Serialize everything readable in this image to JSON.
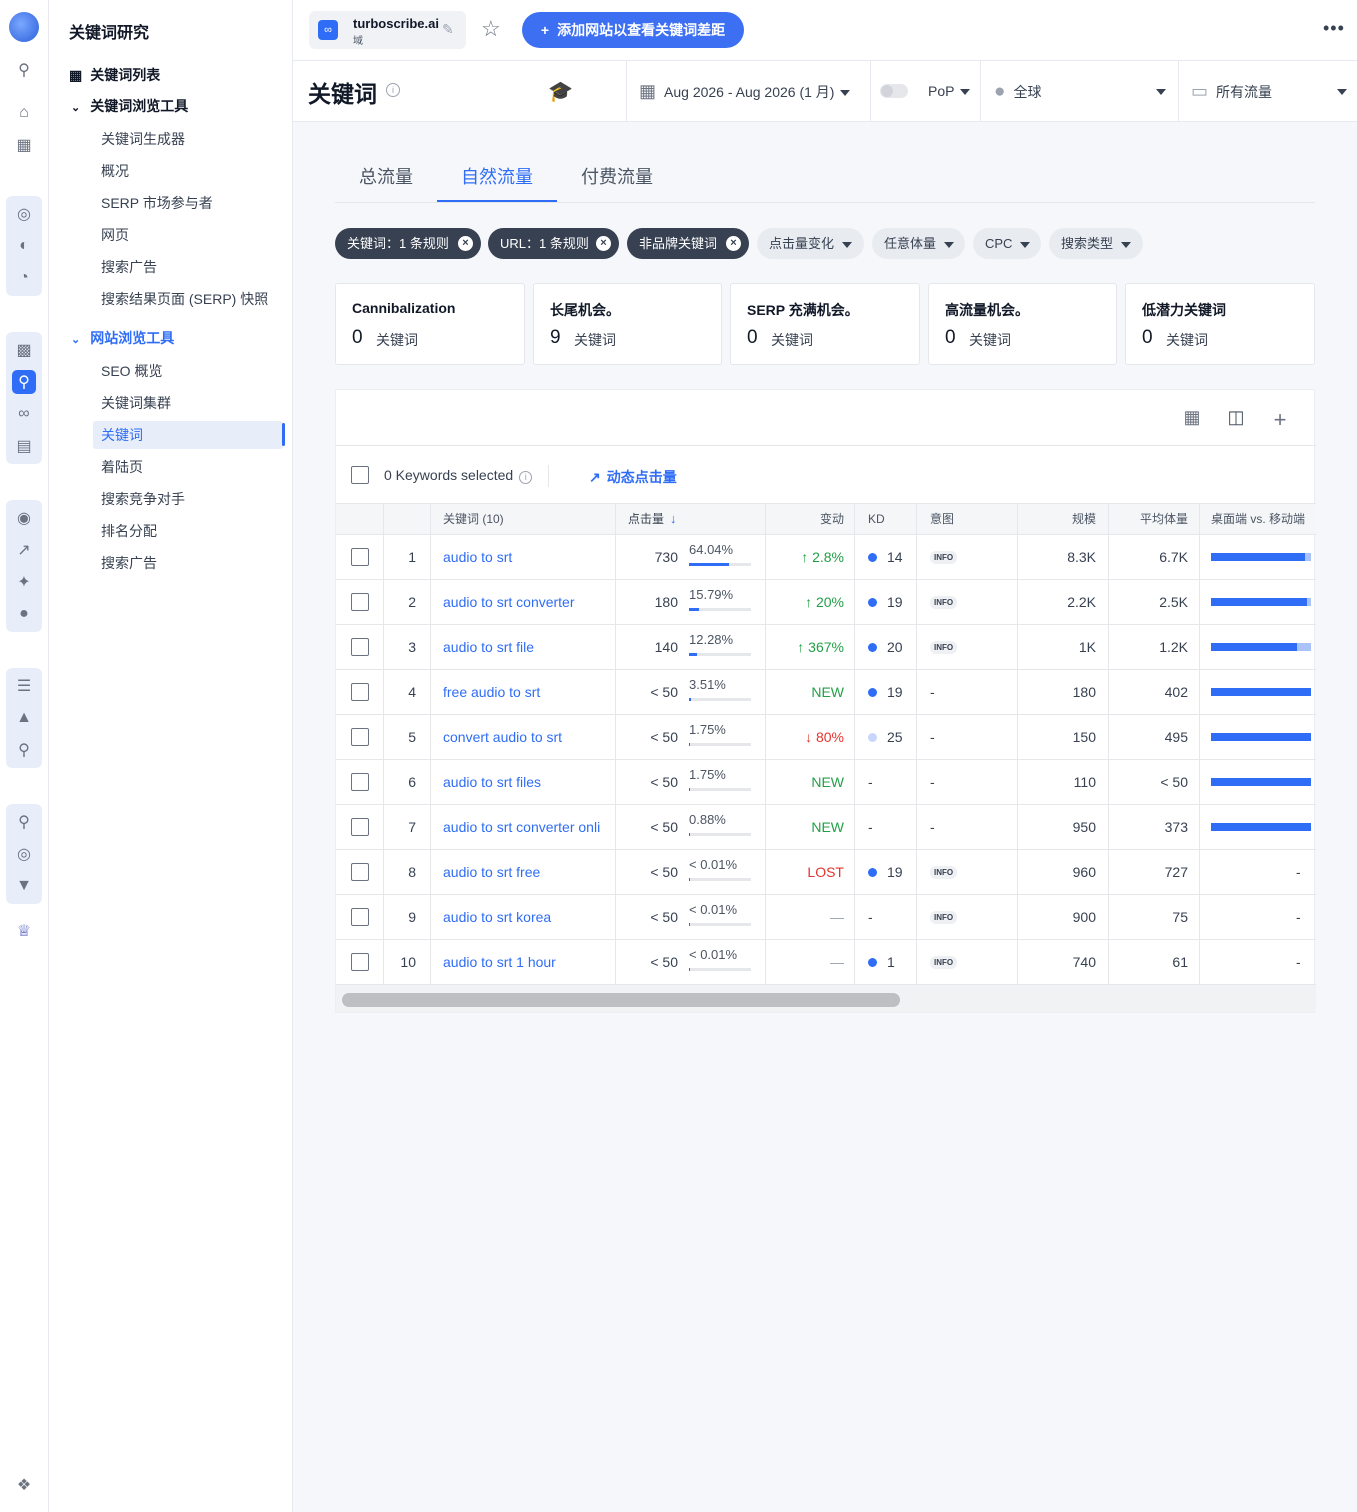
{
  "nav": {
    "title": "关键词研究",
    "items": [
      {
        "label": "关键词列表"
      },
      {
        "label": "关键词浏览工具"
      },
      {
        "label": "关键词生成器"
      },
      {
        "label": "概况"
      },
      {
        "label": "SERP 市场参与者"
      },
      {
        "label": "网页"
      },
      {
        "label": "搜索广告"
      },
      {
        "label": "搜索结果页面 (SERP) 快照"
      },
      {
        "label": "网站浏览工具"
      },
      {
        "label": "SEO 概览"
      },
      {
        "label": "关键词集群"
      },
      {
        "label": "关键词"
      },
      {
        "label": "着陆页"
      },
      {
        "label": "搜索竞争对手"
      },
      {
        "label": "排名分配"
      },
      {
        "label": "搜索广告"
      }
    ]
  },
  "topbar": {
    "domain": "turboscribe.ai",
    "domain_sub": "域",
    "add_button": "添加网站以查看关键词差距"
  },
  "toolbar": {
    "title": "关键词",
    "date_range": "Aug 2026 - Aug 2026 (1 月)",
    "pop": "PoP",
    "region": "全球",
    "traffic": "所有流量"
  },
  "tabs": [
    "总流量",
    "自然流量",
    "付费流量"
  ],
  "filters": [
    {
      "label": "关键词：1 条规则",
      "active": true
    },
    {
      "label": "URL：1 条规则",
      "active": true
    },
    {
      "label": "非品牌关键词",
      "active": true
    },
    {
      "label": "点击量变化",
      "active": false
    },
    {
      "label": "任意体量",
      "active": false
    },
    {
      "label": "CPC",
      "active": false
    },
    {
      "label": "搜索类型",
      "active": false
    }
  ],
  "cards": [
    {
      "title": "Cannibalization",
      "value": "0",
      "unit": "关键词"
    },
    {
      "title": "长尾机会。",
      "value": "9",
      "unit": "关键词"
    },
    {
      "title": "SERP 充满机会。",
      "value": "0",
      "unit": "关键词"
    },
    {
      "title": "高流量机会。",
      "value": "0",
      "unit": "关键词"
    },
    {
      "title": "低潜力关键词",
      "value": "0",
      "unit": "关键词"
    }
  ],
  "table": {
    "selected_text": "0 Keywords selected",
    "dynamic_clicks": "动态点击量",
    "headers": {
      "keyword": "关键词 (10)",
      "clicks": "点击量",
      "change": "变动",
      "kd": "KD",
      "intent": "意图",
      "scale": "规模",
      "avg_volume": "平均体量",
      "device": "桌面端 vs. 移动端"
    },
    "rows": [
      {
        "n": "1",
        "keyword": "audio to srt",
        "clicks": "730",
        "share": "64.04%",
        "share_val": 64.04,
        "change": "↑ 2.8%",
        "change_type": "up",
        "kd": "14",
        "kd_dot": "dark",
        "intent": "INFO",
        "scale": "8.3K",
        "avg": "6.7K",
        "desktop": 0.94
      },
      {
        "n": "2",
        "keyword": "audio to srt converter",
        "clicks": "180",
        "share": "15.79%",
        "share_val": 15.79,
        "change": "↑ 20%",
        "change_type": "up",
        "kd": "19",
        "kd_dot": "dark",
        "intent": "INFO",
        "scale": "2.2K",
        "avg": "2.5K",
        "desktop": 0.96
      },
      {
        "n": "3",
        "keyword": "audio to srt file",
        "clicks": "140",
        "share": "12.28%",
        "share_val": 12.28,
        "change": "↑ 367%",
        "change_type": "up",
        "kd": "20",
        "kd_dot": "dark",
        "intent": "INFO",
        "scale": "1K",
        "avg": "1.2K",
        "desktop": 0.86
      },
      {
        "n": "4",
        "keyword": "free audio to srt",
        "clicks": "< 50",
        "share": "3.51%",
        "share_val": 3.51,
        "change": "NEW",
        "change_type": "new",
        "kd": "19",
        "kd_dot": "dark",
        "intent": "-",
        "scale": "180",
        "avg": "402",
        "desktop": 1.0
      },
      {
        "n": "5",
        "keyword": "convert audio to srt",
        "clicks": "< 50",
        "share": "1.75%",
        "share_val": 1.75,
        "change": "↓ 80%",
        "change_type": "down",
        "kd": "25",
        "kd_dot": "light",
        "intent": "-",
        "scale": "150",
        "avg": "495",
        "desktop": 1.0
      },
      {
        "n": "6",
        "keyword": "audio to srt files",
        "clicks": "< 50",
        "share": "1.75%",
        "share_val": 1.75,
        "change": "NEW",
        "change_type": "new",
        "kd": "-",
        "kd_dot": "none",
        "intent": "-",
        "scale": "110",
        "avg": "< 50",
        "desktop": 1.0
      },
      {
        "n": "7",
        "keyword": "audio to srt converter onli",
        "clicks": "< 50",
        "share": "0.88%",
        "share_val": 0.88,
        "change": "NEW",
        "change_type": "new",
        "kd": "-",
        "kd_dot": "none",
        "intent": "-",
        "scale": "950",
        "avg": "373",
        "desktop": 1.0
      },
      {
        "n": "8",
        "keyword": "audio to srt free",
        "clicks": "< 50",
        "share": "< 0.01%",
        "share_val": 0.01,
        "change": "LOST",
        "change_type": "lost",
        "kd": "19",
        "kd_dot": "dark",
        "intent": "INFO",
        "scale": "960",
        "avg": "727",
        "desktop": null
      },
      {
        "n": "9",
        "keyword": "audio to srt korea",
        "clicks": "< 50",
        "share": "< 0.01%",
        "share_val": 0.01,
        "change": "—",
        "change_type": "dash",
        "kd": "-",
        "kd_dot": "none",
        "intent": "INFO",
        "scale": "900",
        "avg": "75",
        "desktop": null
      },
      {
        "n": "10",
        "keyword": "audio to srt 1 hour",
        "clicks": "< 50",
        "share": "< 0.01%",
        "share_val": 0.01,
        "change": "—",
        "change_type": "dash",
        "kd": "1",
        "kd_dot": "dark",
        "intent": "INFO",
        "scale": "740",
        "avg": "61",
        "desktop": null
      }
    ]
  },
  "colors": {
    "accent": "#2f6df6",
    "up": "#22a047",
    "down": "#e3342f"
  }
}
